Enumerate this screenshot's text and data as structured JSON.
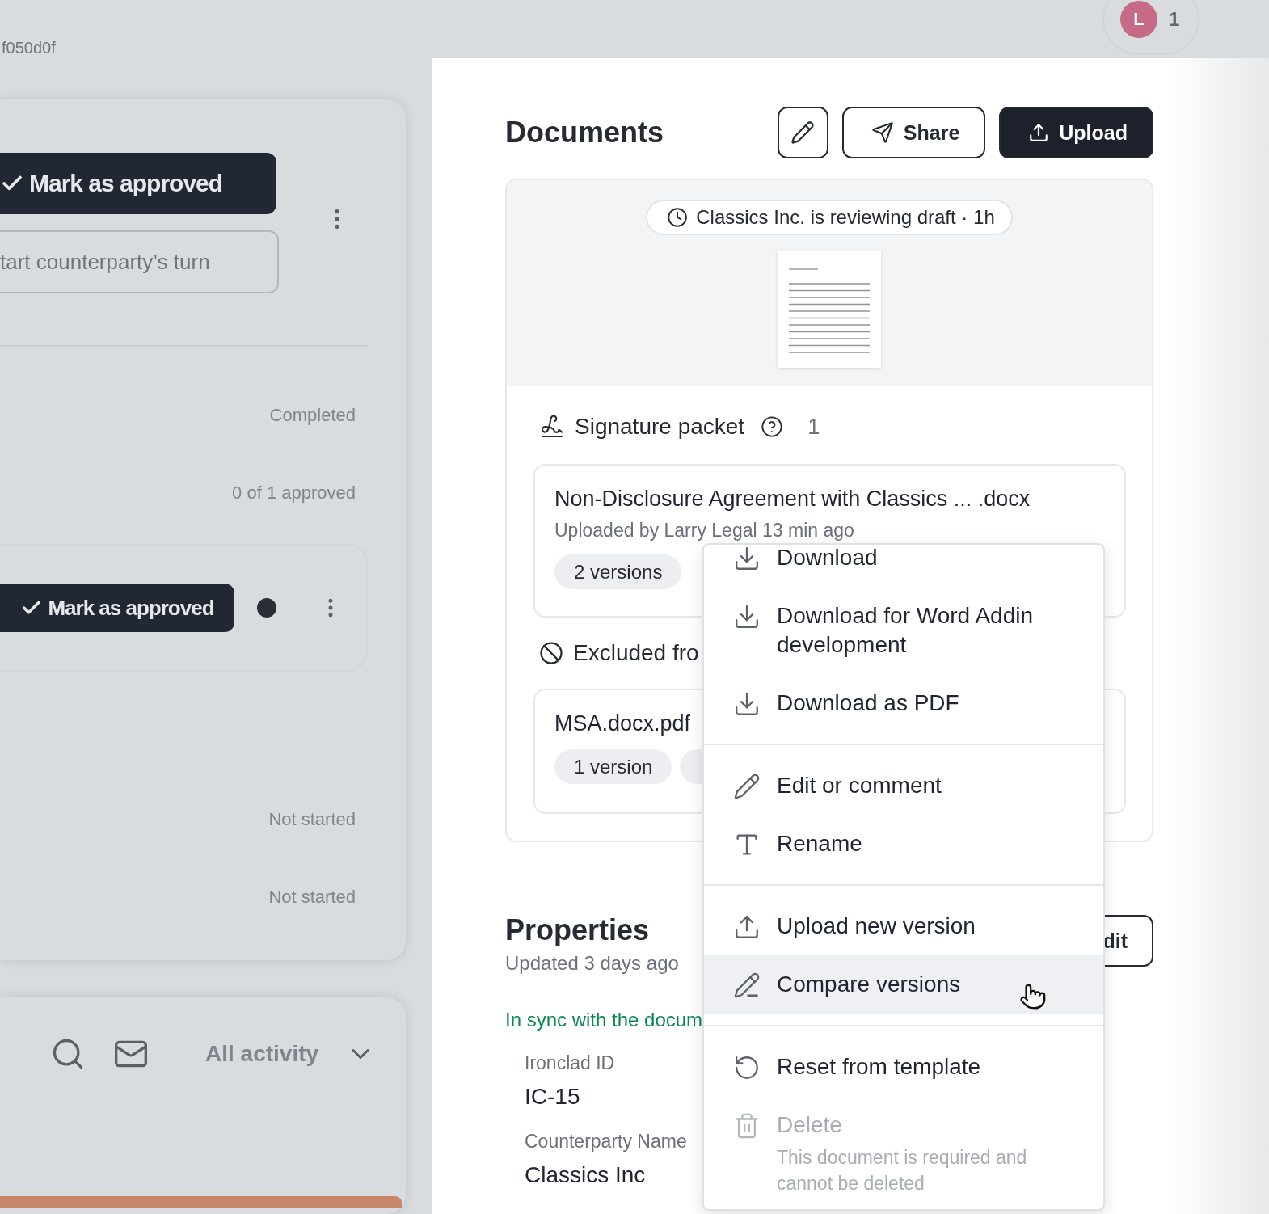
{
  "top_bar": {
    "record_id": "f050d0f",
    "avatar": {
      "initial": "L",
      "count": "1"
    }
  },
  "workflow": {
    "primary_button": "Mark as approved",
    "secondary_button": "tart counterparty’s turn",
    "statuses": [
      "Completed",
      "0 of 1 approved"
    ],
    "step_button": "Mark as approved",
    "later_statuses": [
      "Not started",
      "Not started"
    ]
  },
  "activity": {
    "filter": "All activity",
    "progress": {
      "level": 1
    }
  },
  "documents": {
    "title": "Documents",
    "share_button": "Share",
    "upload_button": "Upload",
    "status_pill": "Classics Inc. is reviewing draft · 1h",
    "signature_packet": {
      "title": "Signature packet",
      "count": "1",
      "file": {
        "name": "Non-Disclosure Agreement with Classics ... .docx",
        "uploaded": "Uploaded by Larry Legal 13 min ago",
        "versions": "2 versions"
      }
    },
    "excluded": {
      "title": "Excluded fro",
      "file": {
        "name": "MSA.docx.pdf",
        "versions": "1 version"
      }
    }
  },
  "properties": {
    "title": "Properties",
    "updated": "Updated 3 days ago",
    "edit_button": "dit",
    "sync_status": "In sync with the docum",
    "fields": [
      {
        "label": "Ironclad ID",
        "value": "IC-15"
      },
      {
        "label": "Counterparty Name",
        "value": "Classics Inc"
      }
    ]
  },
  "menu": {
    "items": [
      {
        "kind": "download",
        "label": "Download",
        "selected": false,
        "disabled": false
      },
      {
        "kind": "download",
        "label": "Download for Word Addin development",
        "selected": false,
        "disabled": false
      },
      {
        "kind": "download",
        "label": "Download as PDF",
        "selected": false,
        "disabled": false
      },
      {
        "kind": "divider"
      },
      {
        "kind": "edit",
        "label": "Edit or comment",
        "selected": false,
        "disabled": false
      },
      {
        "kind": "rename",
        "label": "Rename",
        "selected": false,
        "disabled": false
      },
      {
        "kind": "divider"
      },
      {
        "kind": "upload",
        "label": "Upload new version",
        "selected": false,
        "disabled": false
      },
      {
        "kind": "compare",
        "label": "Compare versions",
        "selected": true,
        "disabled": false
      },
      {
        "kind": "divider"
      },
      {
        "kind": "reset",
        "label": "Reset from template",
        "selected": false,
        "disabled": false
      },
      {
        "kind": "delete",
        "label": "Delete",
        "selected": false,
        "disabled": true,
        "description": "This document is required and cannot be deleted"
      }
    ]
  }
}
